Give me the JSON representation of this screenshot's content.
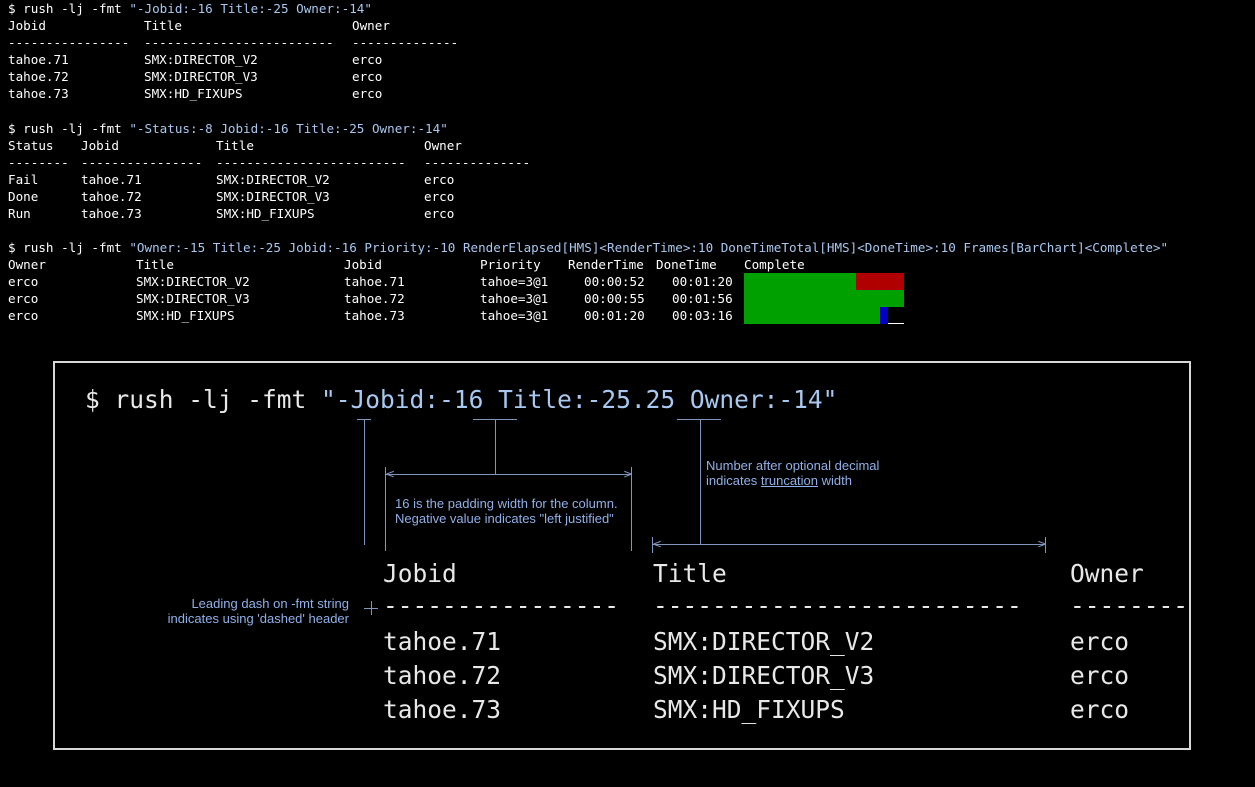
{
  "block1": {
    "prompt": "$ rush -lj -fmt ",
    "fmt": "\"-Jobid:-16 Title:-25 Owner:-14\"",
    "headers": [
      "Jobid",
      "Title",
      "Owner"
    ],
    "dashes": [
      "----------------",
      "-------------------------",
      "--------------"
    ],
    "rows": [
      [
        "tahoe.71",
        "SMX:DIRECTOR_V2",
        "erco"
      ],
      [
        "tahoe.72",
        "SMX:DIRECTOR_V3",
        "erco"
      ],
      [
        "tahoe.73",
        "SMX:HD_FIXUPS",
        "erco"
      ]
    ]
  },
  "block2": {
    "prompt": "$ rush -lj -fmt ",
    "fmt": "\"-Status:-8 Jobid:-16 Title:-25 Owner:-14\"",
    "headers": [
      "Status",
      "Jobid",
      "Title",
      "Owner"
    ],
    "dashes": [
      "--------",
      "----------------",
      "-------------------------",
      "--------------"
    ],
    "rows": [
      [
        "Fail",
        "tahoe.71",
        "SMX:DIRECTOR_V2",
        "erco"
      ],
      [
        "Done",
        "tahoe.72",
        "SMX:DIRECTOR_V3",
        "erco"
      ],
      [
        "Run",
        "tahoe.73",
        "SMX:HD_FIXUPS",
        "erco"
      ]
    ]
  },
  "block3": {
    "prompt": "$ rush -lj -fmt ",
    "fmt": "\"Owner:-15 Title:-25 Jobid:-16 Priority:-10 RenderElapsed[HMS]<RenderTime>:10 DoneTimeTotal[HMS]<DoneTime>:10 Frames[BarChart]<Complete>\"",
    "headers": [
      "Owner",
      "Title",
      "Jobid",
      "Priority",
      "RenderTime",
      "DoneTime",
      "Complete"
    ],
    "rows": [
      [
        "erco",
        "SMX:DIRECTOR_V2",
        "tahoe.71",
        "tahoe=3@1",
        "00:00:52",
        "00:01:20"
      ],
      [
        "erco",
        "SMX:DIRECTOR_V3",
        "tahoe.72",
        "tahoe=3@1",
        "00:00:55",
        "00:01:56"
      ],
      [
        "erco",
        "SMX:HD_FIXUPS",
        "tahoe.73",
        "tahoe=3@1",
        "00:01:20",
        "00:03:16"
      ]
    ],
    "bar_colors": {
      "done": "#00a000",
      "fail": "#b00000",
      "run": "#0000c0",
      "pending": "#000000"
    },
    "bars": [
      {
        "done": 0.7,
        "fail": 0.3,
        "run": 0.0
      },
      {
        "done": 1.0,
        "fail": 0.0,
        "run": 0.0
      },
      {
        "done": 0.85,
        "fail": 0.0,
        "run": 0.05
      }
    ]
  },
  "callout": {
    "prompt": "$ rush -lj -fmt ",
    "fmt_open": "\"",
    "fmt_dash": "-",
    "fmt_jobid": "Jobid:",
    "fmt_jobid_num": "-16",
    "fmt_title": " Title:-25",
    "fmt_trunc": ".25",
    "fmt_owner": " Owner:-14\"",
    "headers": [
      "Jobid",
      "Title",
      "Owner"
    ],
    "dashes": [
      "----------------",
      "-------------------------",
      "--------"
    ],
    "rows": [
      [
        "tahoe.71",
        "SMX:DIRECTOR_V2",
        "erco"
      ],
      [
        "tahoe.72",
        "SMX:DIRECTOR_V3",
        "erco"
      ],
      [
        "tahoe.73",
        "SMX:HD_FIXUPS",
        "erco"
      ]
    ],
    "note_padding": [
      "16 is the padding width for the column.",
      "Negative value indicates \"left justified\""
    ],
    "note_trunc_1": "Number after optional decimal",
    "note_trunc_2a": "indicates ",
    "note_trunc_2b": "truncation",
    "note_trunc_2c": " width",
    "note_dash": [
      "Leading dash on -fmt string",
      "indicates using 'dashed' header"
    ]
  }
}
